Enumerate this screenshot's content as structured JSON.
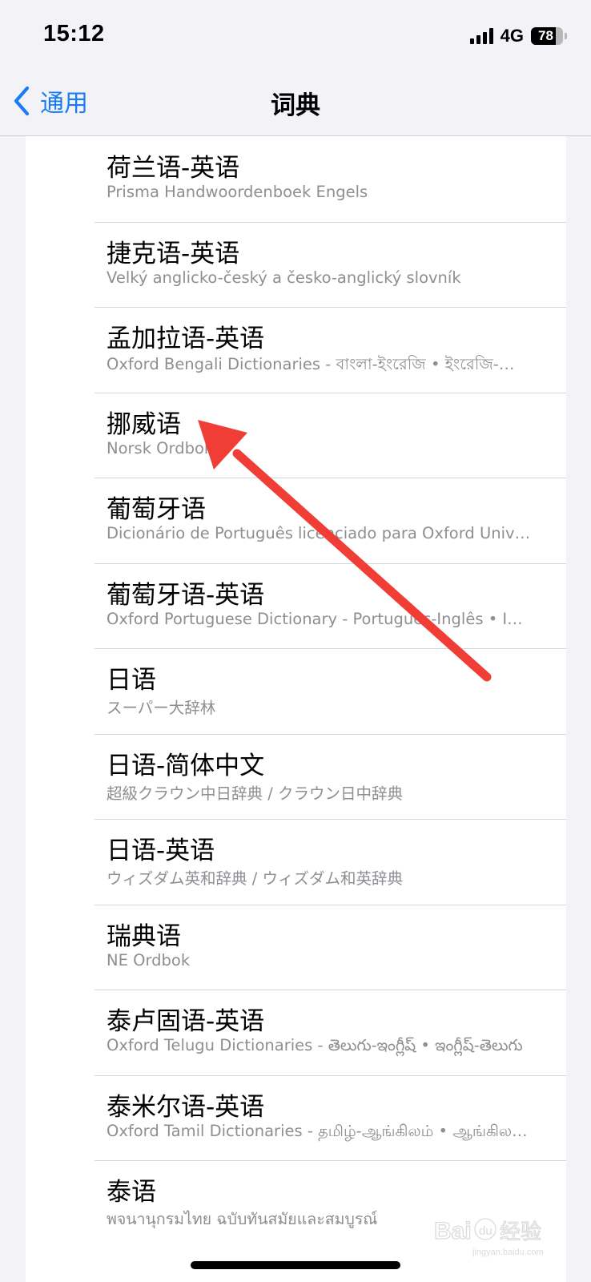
{
  "status_bar": {
    "time": "15:12",
    "network": "4G",
    "battery_level": "78",
    "battery_fraction": 0.78
  },
  "nav": {
    "back_label": "通用",
    "title": "词典"
  },
  "dictionaries": [
    {
      "title": "荷兰语-英语",
      "subtitle": "Prisma Handwoordenboek Engels"
    },
    {
      "title": "捷克语-英语",
      "subtitle": "Velký anglicko-český a česko-anglický slovník"
    },
    {
      "title": "孟加拉语-英语",
      "subtitle": "Oxford Bengali Dictionaries - বাংলা-ইংরেজি • ইংরেজি-বাংলা"
    },
    {
      "title": "挪威语",
      "subtitle": "Norsk Ordbok"
    },
    {
      "title": "葡萄牙语",
      "subtitle": "Dicionário de Português licenciado para Oxford University Press"
    },
    {
      "title": "葡萄牙语-英语",
      "subtitle": "Oxford Portuguese Dictionary - Português-Inglês • Inglês-Português"
    },
    {
      "title": "日语",
      "subtitle": "スーパー大辞林"
    },
    {
      "title": "日语-简体中文",
      "subtitle": "超級クラウン中日辞典 / クラウン日中辞典"
    },
    {
      "title": "日语-英语",
      "subtitle": "ウィズダム英和辞典 / ウィズダム和英辞典"
    },
    {
      "title": "瑞典语",
      "subtitle": "NE Ordbok"
    },
    {
      "title": "泰卢固语-英语",
      "subtitle": "Oxford Telugu Dictionaries - తెలుగు-ఇంగ్లీష్ • ఇంగ్లీష్-తెలుగు"
    },
    {
      "title": "泰米尔语-英语",
      "subtitle": "Oxford Tamil Dictionaries - தமிழ்-ஆங்கிலம் • ஆங்கிலம்-தமிழ்"
    },
    {
      "title": "泰语",
      "subtitle": "พจนานุกรมไทย ฉบับทันสมัยและสมบูรณ์"
    }
  ],
  "watermark": {
    "text": "Baidu经验",
    "url": "jingyan.baidu.com"
  },
  "colors": {
    "accent": "#1a7cf5",
    "arrow": "#f03e36",
    "background": "#f2f2f7",
    "subtitle": "#8e8e93"
  }
}
